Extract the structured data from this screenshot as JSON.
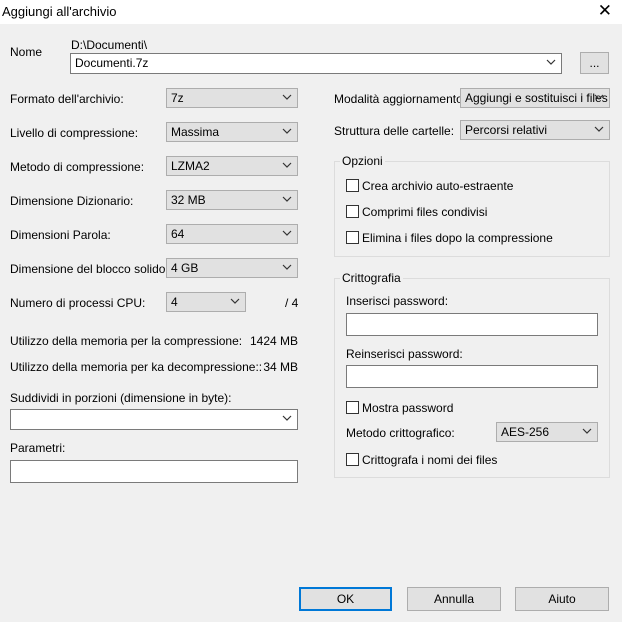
{
  "window": {
    "title": "Aggiungi all'archivio",
    "close_glyph": "✕"
  },
  "name": {
    "label": "Nome",
    "path": "D:\\Documenti\\",
    "value": "Documenti.7z",
    "browse_label": "..."
  },
  "left": {
    "format": {
      "label": "Formato dell'archivio:",
      "value": "7z"
    },
    "level": {
      "label": "Livello di compressione:",
      "value": "Massima"
    },
    "method": {
      "label": "Metodo di compressione:",
      "value": "LZMA2"
    },
    "dict": {
      "label": "Dimensione Dizionario:",
      "value": "32 MB"
    },
    "word": {
      "label": "Dimensioni Parola:",
      "value": "64"
    },
    "solid": {
      "label": "Dimensione del blocco solido:",
      "value": "4 GB"
    },
    "cpu": {
      "label": "Numero di processi CPU:",
      "value": "4",
      "total": "/ 4"
    },
    "mem_comp": {
      "label": "Utilizzo della memoria per la compressione:",
      "value": "1424 MB"
    },
    "mem_decomp": {
      "label": "Utilizzo della memoria per ka decompressione::",
      "value": "34 MB"
    },
    "split": {
      "label": "Suddividi in porzioni (dimensione in byte):",
      "value": ""
    },
    "params": {
      "label": "Parametri:",
      "value": ""
    }
  },
  "right": {
    "update_mode": {
      "label": "Modalità aggiornamento:",
      "value": "Aggiungi e sostituisci i files"
    },
    "path_mode": {
      "label": "Struttura delle cartelle:",
      "value": "Percorsi relativi"
    },
    "options": {
      "title": "Opzioni",
      "sfx": {
        "label": "Crea archivio auto-estraente",
        "checked": false
      },
      "shared": {
        "label": "Comprimi files condivisi",
        "checked": false
      },
      "delete": {
        "label": "Elimina i files dopo la compressione",
        "checked": false
      }
    },
    "encryption": {
      "title": "Crittografia",
      "password_label": "Inserisci password:",
      "password_value": "",
      "repassword_label": "Reinserisci password:",
      "repassword_value": "",
      "show_password": {
        "label": "Mostra password",
        "checked": false
      },
      "method_label": "Metodo crittografico:",
      "method_value": "AES-256",
      "encrypt_names": {
        "label": "Crittografa i nomi dei files",
        "checked": false
      }
    }
  },
  "buttons": {
    "ok": "OK",
    "cancel": "Annulla",
    "help": "Aiuto"
  },
  "colors": {
    "focus_border": "#0078d7",
    "dialog_bg": "#f0f0f0"
  },
  "icons": {
    "dropdown": "chevron-down-icon",
    "close": "close-icon"
  }
}
